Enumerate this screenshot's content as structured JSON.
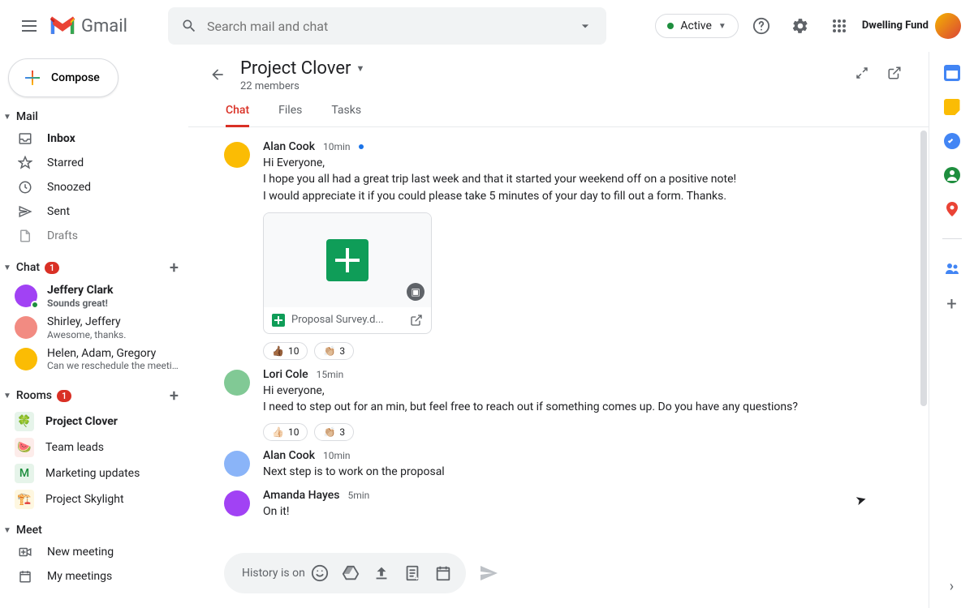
{
  "app": {
    "name": "Gmail",
    "search_placeholder": "Search mail and chat",
    "status": "Active",
    "org": "Dwelling Fund"
  },
  "compose_label": "Compose",
  "sections": {
    "mail": {
      "label": "Mail",
      "items": [
        {
          "icon": "inbox",
          "label": "Inbox",
          "bold": true
        },
        {
          "icon": "star",
          "label": "Starred"
        },
        {
          "icon": "clock",
          "label": "Snoozed"
        },
        {
          "icon": "send",
          "label": "Sent"
        },
        {
          "icon": "file",
          "label": "Drafts"
        }
      ]
    },
    "chat": {
      "label": "Chat",
      "badge": "1",
      "items": [
        {
          "name": "Jeffery Clark",
          "snippet": "Sounds great!",
          "bold": true,
          "presence": true
        },
        {
          "name": "Shirley, Jeffery",
          "snippet": "Awesome, thanks."
        },
        {
          "name": "Helen, Adam, Gregory",
          "snippet": "Can we reschedule the meeti..."
        }
      ]
    },
    "rooms": {
      "label": "Rooms",
      "badge": "1",
      "items": [
        {
          "emoji": "🍀",
          "label": "Project Clover",
          "bold": true,
          "bg": "#e6f4ea"
        },
        {
          "emoji": "🍉",
          "label": "Team leads",
          "bg": "#fdecea"
        },
        {
          "letter": "M",
          "label": "Marketing updates",
          "bg": "#e6f4ea",
          "color": "#1e8e3e"
        },
        {
          "emoji": "🏗️",
          "label": "Project Skylight",
          "bg": "#fef7e0"
        }
      ]
    },
    "meet": {
      "label": "Meet",
      "items": [
        {
          "icon": "video",
          "label": "New meeting"
        },
        {
          "icon": "calendar",
          "label": "My meetings"
        }
      ]
    }
  },
  "room": {
    "title": "Project Clover",
    "subtitle": "22 members",
    "tabs": [
      "Chat",
      "Files",
      "Tasks"
    ],
    "active_tab": 0
  },
  "messages": [
    {
      "author": "Alan Cook",
      "time": "10min",
      "unread": true,
      "lines": [
        "Hi Everyone,",
        "I hope you all had a great trip last week and that it started your weekend off on a positive note!",
        "I would appreciate it if you could please take 5 minutes of your day to fill out a form. Thanks."
      ],
      "attachment": {
        "name": "Proposal Survey.d..."
      },
      "reactions": [
        {
          "emoji": "👍🏾",
          "count": "10"
        },
        {
          "emoji": "👏🏼",
          "count": "3"
        }
      ]
    },
    {
      "author": "Lori Cole",
      "time": "15min",
      "lines": [
        "Hi everyone,",
        "I need to step out for an min, but feel free to reach out if something comes up.  Do you have any questions?"
      ],
      "reactions": [
        {
          "emoji": "👍🏻",
          "count": "10"
        },
        {
          "emoji": "👏🏼",
          "count": "3"
        }
      ]
    },
    {
      "author": "Alan Cook",
      "time": "10min",
      "lines": [
        "Next step is to work on the proposal"
      ]
    },
    {
      "author": "Amanda Hayes",
      "time": "5min",
      "lines": [
        "On it!"
      ]
    }
  ],
  "composer": {
    "hint": "History is on"
  },
  "avatar_colors": [
    "#a142f4",
    "#f28b82",
    "#fbbc04",
    "#81c995",
    "#8ab4f8"
  ]
}
